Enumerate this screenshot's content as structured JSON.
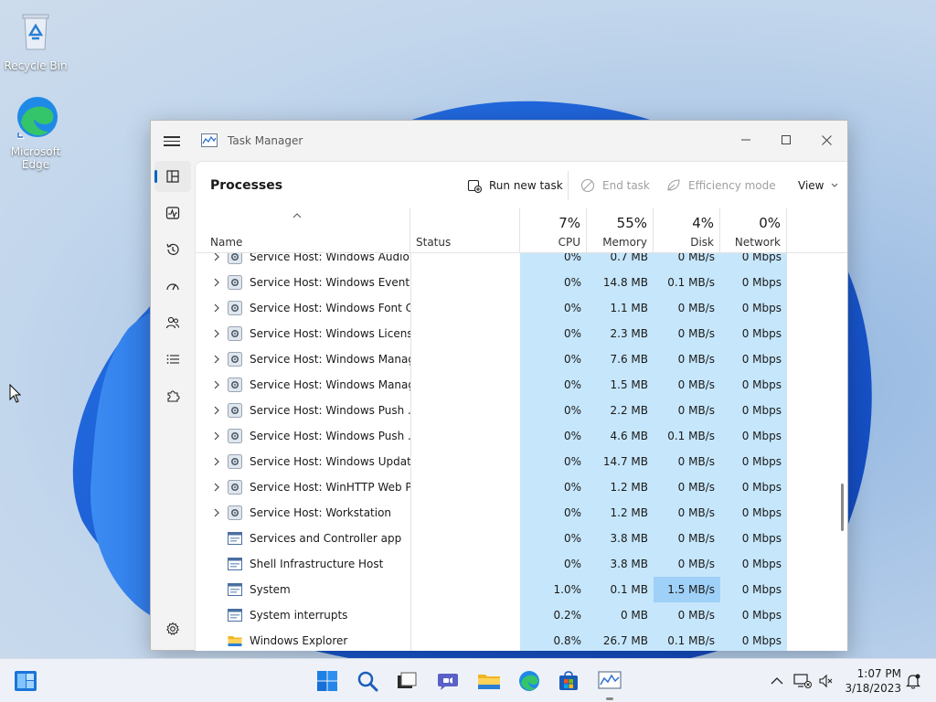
{
  "desktop": {
    "icons": [
      {
        "label": "Recycle Bin"
      },
      {
        "label": "Microsoft Edge"
      }
    ]
  },
  "window": {
    "title": "Task Manager",
    "page_title": "Processes",
    "toolbar": {
      "run_new_task": "Run new task",
      "end_task": "End task",
      "efficiency_mode": "Efficiency mode",
      "view": "View"
    },
    "columns": {
      "name": "Name",
      "status": "Status",
      "cpu": {
        "percent": "7%",
        "label": "CPU"
      },
      "memory": {
        "percent": "55%",
        "label": "Memory"
      },
      "disk": {
        "percent": "4%",
        "label": "Disk"
      },
      "network": {
        "percent": "0%",
        "label": "Network"
      }
    },
    "rows": [
      {
        "name": "Service Host: Windows Audio ...",
        "cpu": "0%",
        "memory": "0.7 MB",
        "disk": "0 MB/s",
        "network": "0 Mbps",
        "expandable": true,
        "icon": "gear"
      },
      {
        "name": "Service Host: Windows Event ...",
        "cpu": "0%",
        "memory": "14.8 MB",
        "disk": "0.1 MB/s",
        "network": "0 Mbps",
        "expandable": true,
        "icon": "gear"
      },
      {
        "name": "Service Host: Windows Font C...",
        "cpu": "0%",
        "memory": "1.1 MB",
        "disk": "0 MB/s",
        "network": "0 Mbps",
        "expandable": true,
        "icon": "gear"
      },
      {
        "name": "Service Host: Windows Licens...",
        "cpu": "0%",
        "memory": "2.3 MB",
        "disk": "0 MB/s",
        "network": "0 Mbps",
        "expandable": true,
        "icon": "gear"
      },
      {
        "name": "Service Host: Windows Manag...",
        "cpu": "0%",
        "memory": "7.6 MB",
        "disk": "0 MB/s",
        "network": "0 Mbps",
        "expandable": true,
        "icon": "gear"
      },
      {
        "name": "Service Host: Windows Manag...",
        "cpu": "0%",
        "memory": "1.5 MB",
        "disk": "0 MB/s",
        "network": "0 Mbps",
        "expandable": true,
        "icon": "gear"
      },
      {
        "name": "Service Host: Windows Push ...",
        "cpu": "0%",
        "memory": "2.2 MB",
        "disk": "0 MB/s",
        "network": "0 Mbps",
        "expandable": true,
        "icon": "gear"
      },
      {
        "name": "Service Host: Windows Push ...",
        "cpu": "0%",
        "memory": "4.6 MB",
        "disk": "0.1 MB/s",
        "network": "0 Mbps",
        "expandable": true,
        "icon": "gear"
      },
      {
        "name": "Service Host: Windows Update",
        "cpu": "0%",
        "memory": "14.7 MB",
        "disk": "0 MB/s",
        "network": "0 Mbps",
        "expandable": true,
        "icon": "gear"
      },
      {
        "name": "Service Host: WinHTTP Web P...",
        "cpu": "0%",
        "memory": "1.2 MB",
        "disk": "0 MB/s",
        "network": "0 Mbps",
        "expandable": true,
        "icon": "gear"
      },
      {
        "name": "Service Host: Workstation",
        "cpu": "0%",
        "memory": "1.2 MB",
        "disk": "0 MB/s",
        "network": "0 Mbps",
        "expandable": true,
        "icon": "gear"
      },
      {
        "name": "Services and Controller app",
        "cpu": "0%",
        "memory": "3.8 MB",
        "disk": "0 MB/s",
        "network": "0 Mbps",
        "expandable": false,
        "icon": "window"
      },
      {
        "name": "Shell Infrastructure Host",
        "cpu": "0%",
        "memory": "3.8 MB",
        "disk": "0 MB/s",
        "network": "0 Mbps",
        "expandable": false,
        "icon": "window"
      },
      {
        "name": "System",
        "cpu": "1.0%",
        "memory": "0.1 MB",
        "disk": "1.5 MB/s",
        "network": "0 Mbps",
        "expandable": false,
        "icon": "window",
        "disk_hot": true
      },
      {
        "name": "System interrupts",
        "cpu": "0.2%",
        "memory": "0 MB",
        "disk": "0 MB/s",
        "network": "0 Mbps",
        "expandable": false,
        "icon": "window"
      },
      {
        "name": "Windows Explorer",
        "cpu": "0.8%",
        "memory": "26.7 MB",
        "disk": "0.1 MB/s",
        "network": "0 Mbps",
        "expandable": false,
        "icon": "folder"
      }
    ]
  },
  "taskbar": {
    "time": "1:07 PM",
    "date": "3/18/2023"
  },
  "colors": {
    "accent": "#0067c0",
    "heat_low": "#c6e6fb",
    "heat_high": "#9fd0f7"
  }
}
